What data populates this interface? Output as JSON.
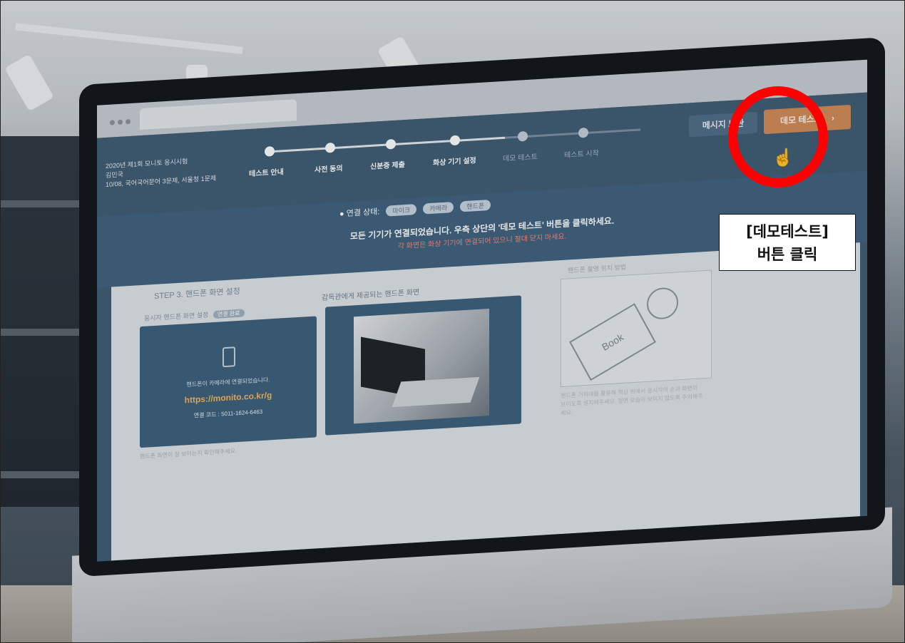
{
  "app": {
    "info_lines": [
      "2020년 제1회 모니토 응시시험",
      "김민국",
      "10/08, 국어국어문어 3문제, 서울청 1문제"
    ]
  },
  "steps": [
    {
      "label": "테스트 안내",
      "active": true
    },
    {
      "label": "사전 동의",
      "active": true
    },
    {
      "label": "신분증 제출",
      "active": true
    },
    {
      "label": "화상 기기 설정",
      "active": true
    },
    {
      "label": "데모 테스트",
      "active": false
    },
    {
      "label": "테스트 시작",
      "active": false
    }
  ],
  "toolbar": {
    "message_button": "메시지 보관",
    "demo_button": "데모 테스트",
    "demo_chevron": "›"
  },
  "status": {
    "connection_label": "연결 상태:",
    "pills": [
      "마이크",
      "카메라",
      "핸드폰"
    ],
    "message_main": "모든 기기가 연결되었습니다. 우측 상단의 '데모 테스트' 버튼을 클릭하세요.",
    "message_warning": "각 화면은 화상 기기에 연결되어 있으니 절대 닫지 마세요."
  },
  "content": {
    "step_title": "STEP 3. 핸드폰 화면 설정",
    "phone_section_label": "응시자 핸드폰 화면 설정",
    "phone_tag": "연결 완료",
    "viewer_label": "감독관에게 제공되는 핸드폰 화면",
    "guide_label": "핸드폰 촬영 위치 방법",
    "card_text": "핸드폰이 카메라에 연결되었습니다.",
    "card_url": "https://monito.co.kr/g",
    "card_code": "연결 코드 : 5011-1624-6463",
    "illus_book": "Book",
    "illus_caption": "핸드폰 거치대를 활용해 책상 위에서 응시자의 손과 화면이 보이도록 설치해주세요. 정면 모습이 보이지 않도록 주의해주세요.",
    "footnote": "핸드폰 화면이 잘 보이는지 확인해주세요."
  },
  "annotation": {
    "callout_line1": "[데모테스트]",
    "callout_line2": "버튼 클릭",
    "ring_color": "#ff0000"
  },
  "hardware": {
    "logo": "apple-logo"
  }
}
